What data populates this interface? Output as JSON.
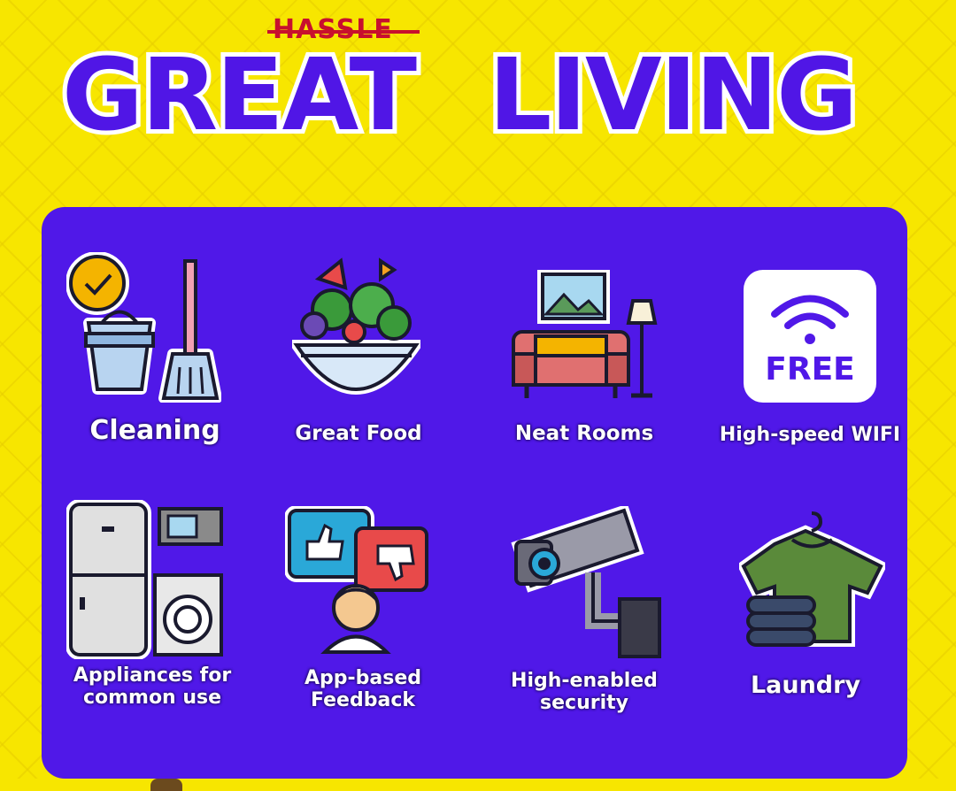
{
  "header": {
    "struck_word": "HASSLE",
    "headline_word_1": "GREAT",
    "headline_word_2": "LIVING"
  },
  "colors": {
    "background": "#f7e600",
    "headline": "#5016e6",
    "panel": "#5018e8",
    "strike": "#c8102e"
  },
  "amenities": [
    {
      "label": "Cleaning",
      "icon": "bucket-broom-icon"
    },
    {
      "label": "Great Food",
      "icon": "salad-bowl-icon"
    },
    {
      "label": "Neat Rooms",
      "icon": "sofa-lamp-icon"
    },
    {
      "label": "High-speed WIFI",
      "icon": "free-wifi-icon"
    },
    {
      "label": "Appliances for common use",
      "icon": "appliances-icon"
    },
    {
      "label": "App-based Feedback",
      "icon": "feedback-icon"
    },
    {
      "label": "High-enabled security",
      "icon": "security-camera-icon"
    },
    {
      "label": "Laundry",
      "icon": "laundry-shirt-icon"
    }
  ],
  "wifi_badge": "FREE"
}
